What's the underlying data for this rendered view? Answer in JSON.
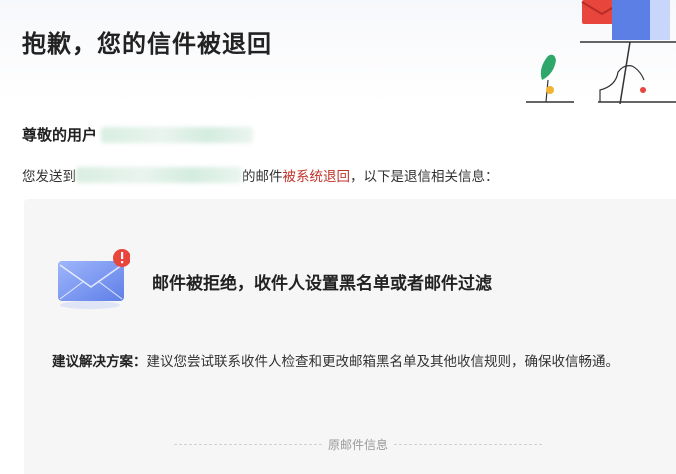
{
  "page": {
    "title": "抱歉，您的信件被退回"
  },
  "greeting": {
    "prefix": "尊敬的用户"
  },
  "notice": {
    "prefix": "您发送到",
    "middle": "的邮件",
    "highlight": "被系统退回",
    "suffix": "，以下是退信相关信息："
  },
  "reason": {
    "text": "邮件被拒绝，收件人设置黑名单或者邮件过滤"
  },
  "suggestion": {
    "label": "建议解决方案：",
    "text": "建议您尝试联系收件人检查和更改邮箱黑名单及其他收信规则，确保收信畅通。"
  },
  "original": {
    "label": "原邮件信息"
  },
  "colors": {
    "accent_red": "#c0342b",
    "envelope_blue": "#6d8ef0",
    "badge_red": "#e8453c"
  }
}
